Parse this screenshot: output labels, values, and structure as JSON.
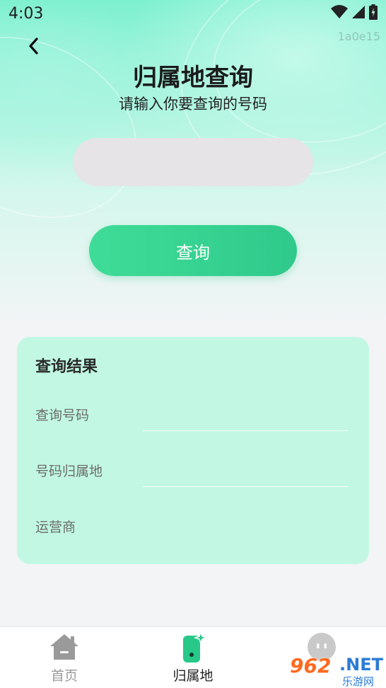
{
  "status_bar": {
    "time": "4:03",
    "icons": [
      "wifi-icon",
      "signal-icon",
      "battery-charging-icon"
    ]
  },
  "watermark_id": "1a0e15",
  "header": {
    "back_icon": "chevron-left-icon",
    "title": "归属地查询",
    "subtitle": "请输入你要查询的号码"
  },
  "search": {
    "value": "",
    "placeholder": ""
  },
  "query_button": {
    "label": "查询"
  },
  "result": {
    "title": "查询结果",
    "rows": [
      {
        "label": "查询号码",
        "value": ""
      },
      {
        "label": "号码归属地",
        "value": ""
      },
      {
        "label": "运营商",
        "value": ""
      }
    ]
  },
  "tabs": [
    {
      "label": "首页",
      "icon": "home-icon",
      "active": false
    },
    {
      "label": "归属地",
      "icon": "phone-sparkle-icon",
      "active": true
    },
    {
      "label": "",
      "icon": "profile-icon",
      "active": false
    }
  ],
  "site_watermark": {
    "number": "962",
    "domain": ".NET",
    "name": "乐游网"
  },
  "colors": {
    "accent": "#2fca8b",
    "card_bg": "#c2f8e3",
    "tab_active": "#27c888",
    "tab_inactive": "#9a9a9a"
  }
}
